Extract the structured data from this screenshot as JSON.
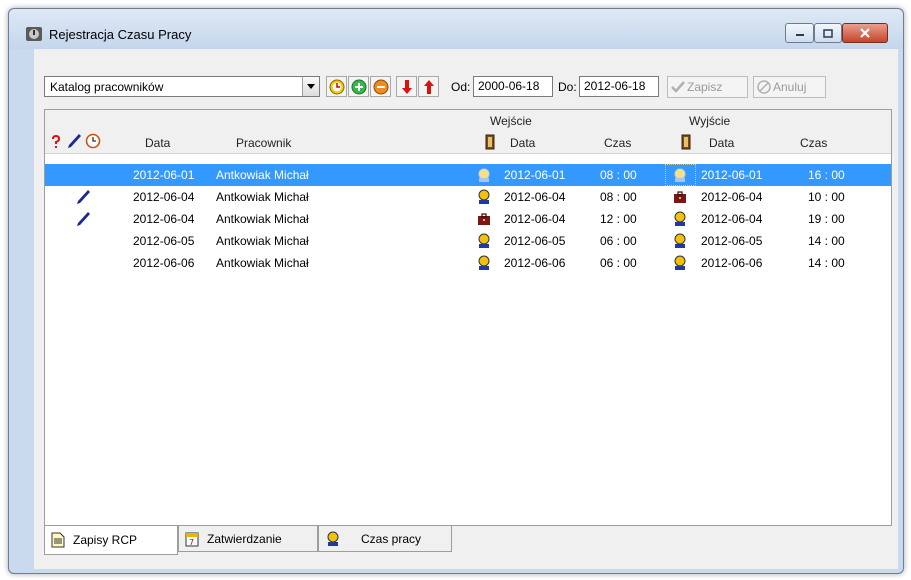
{
  "window": {
    "title": "Rejestracja Czasu Pracy"
  },
  "toolbar": {
    "combo_value": "Katalog pracowników",
    "od_label": "Od:",
    "od_value": "2000-06-18",
    "do_label": "Do:",
    "do_value": "2012-06-18",
    "save_label": "Zapisz",
    "cancel_label": "Anuluj"
  },
  "grid": {
    "group_in": "Wejście",
    "group_out": "Wyjście",
    "col_date": "Data",
    "col_employee": "Pracownik",
    "col_in_date": "Data",
    "col_in_time": "Czas",
    "col_out_date": "Data",
    "col_out_time": "Czas",
    "rows": [
      {
        "date": "2012-06-01",
        "employee": "Antkowiak Michał",
        "in_date": "2012-06-01",
        "in_time": "08 : 00",
        "out_date": "2012-06-01",
        "out_time": "16 : 00",
        "edited": false,
        "selected": true,
        "in_icon": "person-icon",
        "out_icon": "person-icon"
      },
      {
        "date": "2012-06-04",
        "employee": "Antkowiak Michał",
        "in_date": "2012-06-04",
        "in_time": "08 : 00",
        "out_date": "2012-06-04",
        "out_time": "10 : 00",
        "edited": true,
        "selected": false,
        "in_icon": "person-icon",
        "out_icon": "briefcase-icon"
      },
      {
        "date": "2012-06-04",
        "employee": "Antkowiak Michał",
        "in_date": "2012-06-04",
        "in_time": "12 : 00",
        "out_date": "2012-06-04",
        "out_time": "19 : 00",
        "edited": true,
        "selected": false,
        "in_icon": "briefcase-icon",
        "out_icon": "person-icon"
      },
      {
        "date": "2012-06-05",
        "employee": "Antkowiak Michał",
        "in_date": "2012-06-05",
        "in_time": "06 : 00",
        "out_date": "2012-06-05",
        "out_time": "14 : 00",
        "edited": false,
        "selected": false,
        "in_icon": "person-icon",
        "out_icon": "person-icon"
      },
      {
        "date": "2012-06-06",
        "employee": "Antkowiak Michał",
        "in_date": "2012-06-06",
        "in_time": "06 : 00",
        "out_date": "2012-06-06",
        "out_time": "14 : 00",
        "edited": false,
        "selected": false,
        "in_icon": "person-icon",
        "out_icon": "person-icon"
      }
    ]
  },
  "tabs": [
    {
      "label": "Zapisy RCP",
      "icon": "document-icon",
      "active": true
    },
    {
      "label": "Zatwierdzanie",
      "icon": "calendar-icon",
      "active": false
    },
    {
      "label": "Czas pracy",
      "icon": "person-icon",
      "active": false
    }
  ],
  "colors": {
    "selection": "#3399ff",
    "close_button": "#c6442a"
  }
}
